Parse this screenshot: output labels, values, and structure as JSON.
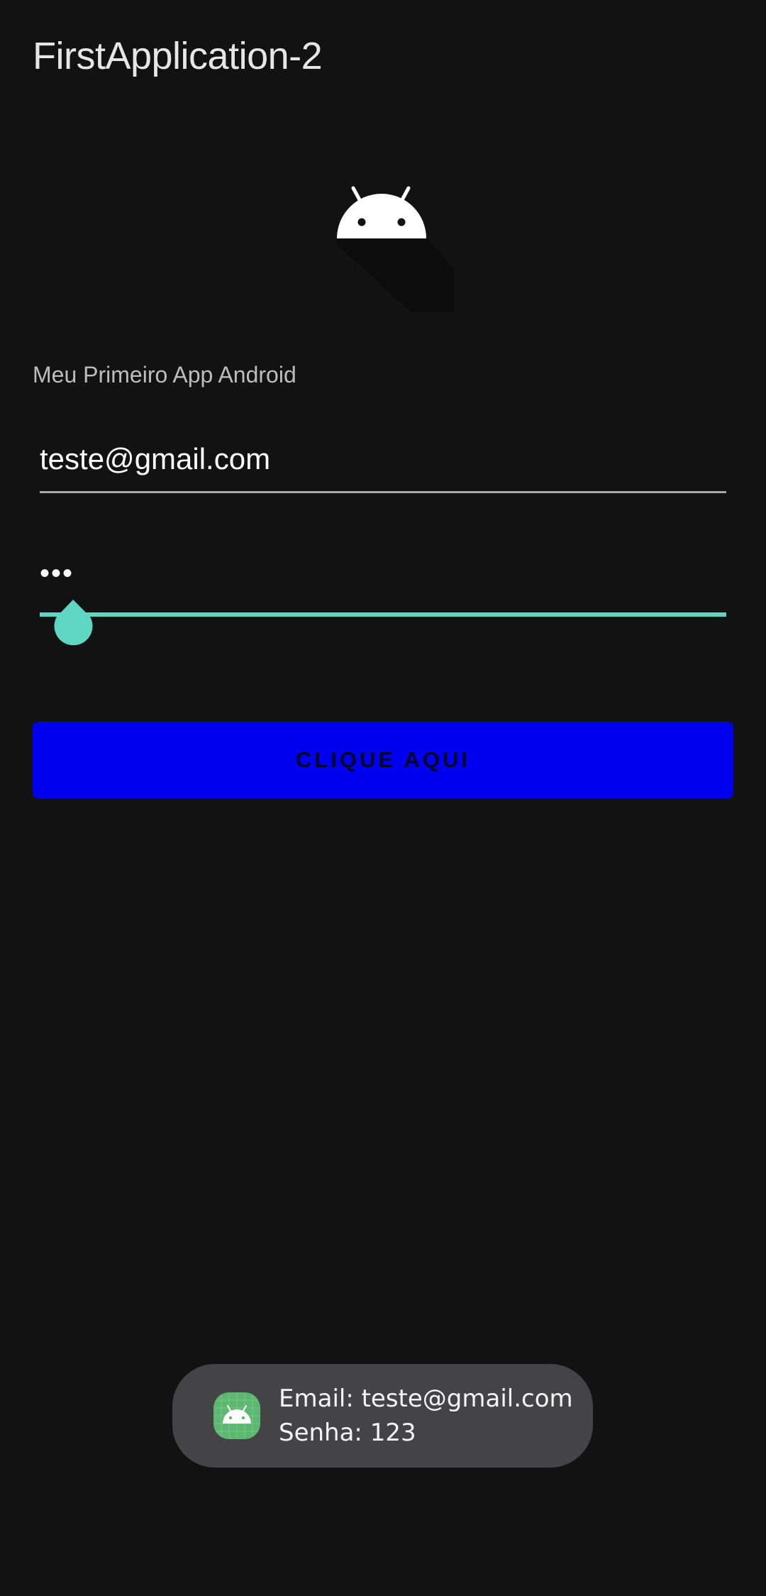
{
  "app": {
    "title": "FirstApplication-2"
  },
  "logo": {
    "icon": "android-robot-icon",
    "color": "#ffffff"
  },
  "subtitle": "Meu Primeiro App Android",
  "form": {
    "email_value": "teste@gmail.com",
    "password_value": "•••",
    "accent_color": "#5fd6c2"
  },
  "button": {
    "label": "CLIQUE AQUI",
    "color": "#0000ee"
  },
  "toast": {
    "icon": "android-app-icon",
    "line1": "Email: teste@gmail.com",
    "line2": "Senha: 123"
  }
}
